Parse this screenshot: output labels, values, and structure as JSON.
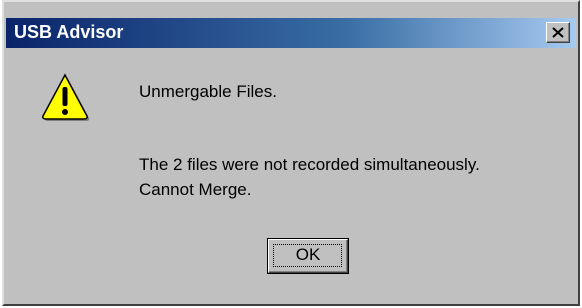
{
  "dialog": {
    "title": "USB Advisor",
    "close_icon": "close-icon",
    "warning_icon": "warning-icon",
    "heading": "Unmergable Files.",
    "message_line1": "The 2 files were not recorded simultaneously.",
    "message_line2": "Cannot Merge.",
    "ok_label": "OK"
  },
  "colors": {
    "window_bg": "#c0c0c0",
    "titlebar_start": "#0a246a",
    "titlebar_end": "#a6caf0",
    "title_text": "#ffffff",
    "warning_fill": "#ffff00"
  }
}
